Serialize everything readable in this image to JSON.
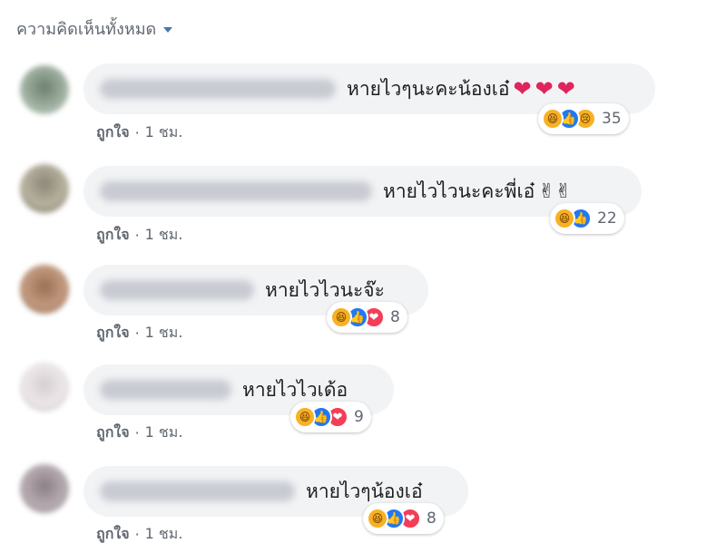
{
  "header": {
    "filter_label": "ความคิดเห็นทั้งหมด"
  },
  "comments": [
    {
      "text": "หายไวๆนะคะน้องเอ๋",
      "extra": "hearts",
      "action_like": "ถูกใจ",
      "separator": "·",
      "time": "1 ชม.",
      "reactions": [
        "haha",
        "like",
        "sad"
      ],
      "reaction_count": "35"
    },
    {
      "text": "หายไวไวนะคะพี่เอ๋",
      "extra": "victory",
      "action_like": "ถูกใจ",
      "separator": "·",
      "time": "1 ชม.",
      "reactions": [
        "haha",
        "like"
      ],
      "reaction_count": "22"
    },
    {
      "text": "หายไวไวนะจ๊ะ",
      "extra": "",
      "action_like": "ถูกใจ",
      "separator": "·",
      "time": "1 ชม.",
      "reactions": [
        "haha",
        "like",
        "love"
      ],
      "reaction_count": "8"
    },
    {
      "text": "หายไวไวเด้อ",
      "extra": "",
      "action_like": "ถูกใจ",
      "separator": "·",
      "time": "1 ชม.",
      "reactions": [
        "haha",
        "like",
        "love"
      ],
      "reaction_count": "9"
    },
    {
      "text": "หายไวๆน้องเอ๋",
      "extra": "",
      "action_like": "ถูกใจ",
      "separator": "·",
      "time": "1 ชม.",
      "reactions": [
        "haha",
        "like",
        "love"
      ],
      "reaction_count": "8"
    }
  ],
  "icons": {
    "heart": "red-heart",
    "victory": "victory-hand",
    "haha": "haha-reaction",
    "like": "like-reaction",
    "sad": "sad-reaction",
    "love": "love-reaction"
  }
}
